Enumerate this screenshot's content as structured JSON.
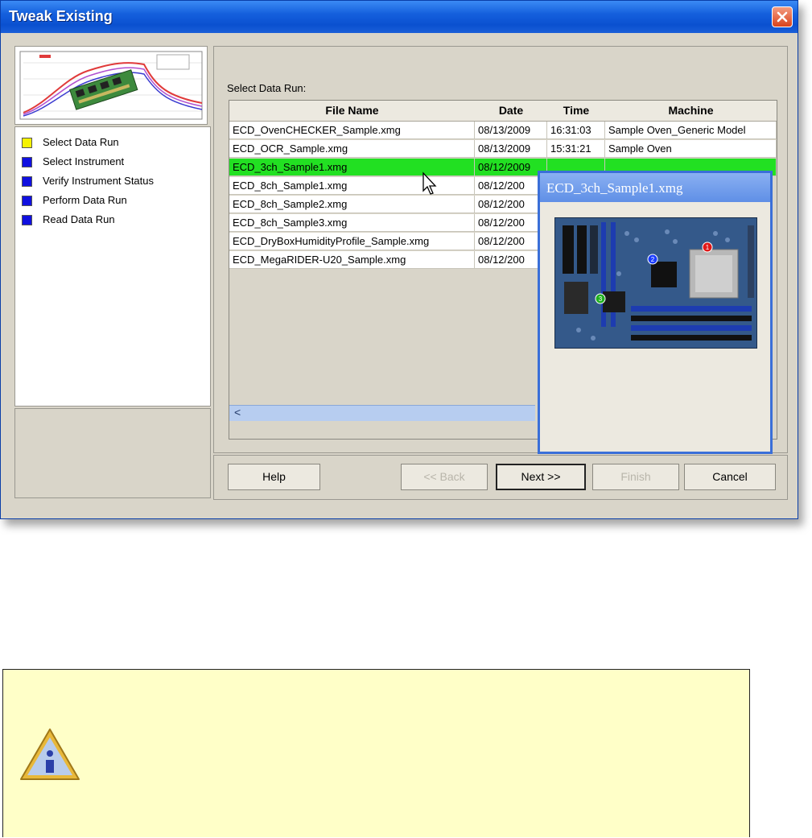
{
  "window": {
    "title": "Tweak Existing",
    "close_glyph": "✕"
  },
  "steps": [
    {
      "label": "Select Data Run",
      "color": "#f5f200"
    },
    {
      "label": "Select Instrument",
      "color": "#1010e0"
    },
    {
      "label": "Verify Instrument Status",
      "color": "#1010e0"
    },
    {
      "label": "Perform Data Run",
      "color": "#1010e0"
    },
    {
      "label": "Read Data Run",
      "color": "#1010e0"
    }
  ],
  "main": {
    "select_label": "Select Data Run:",
    "columns": [
      "File Name",
      "Date",
      "Time",
      "Machine"
    ],
    "rows": [
      {
        "file": "ECD_OvenCHECKER_Sample.xmg",
        "date": "08/13/2009",
        "time": "16:31:03",
        "machine": "Sample Oven_Generic Model"
      },
      {
        "file": "ECD_OCR_Sample.xmg",
        "date": "08/13/2009",
        "time": "15:31:21",
        "machine": "Sample Oven"
      },
      {
        "file": "ECD_3ch_Sample1.xmg",
        "date": "08/12/2009",
        "time": "",
        "machine": "",
        "selected": true
      },
      {
        "file": "ECD_8ch_Sample1.xmg",
        "date": "08/12/200",
        "time": "",
        "machine": ""
      },
      {
        "file": "ECD_8ch_Sample2.xmg",
        "date": "08/12/200",
        "time": "",
        "machine": ""
      },
      {
        "file": "ECD_8ch_Sample3.xmg",
        "date": "08/12/200",
        "time": "",
        "machine": ""
      },
      {
        "file": "ECD_DryBoxHumidityProfile_Sample.xmg",
        "date": "08/12/200",
        "time": "",
        "machine": ""
      },
      {
        "file": "ECD_MegaRIDER-U20_Sample.xmg",
        "date": "08/12/200",
        "time": "",
        "machine": ""
      }
    ],
    "scroll_left_glyph": "<"
  },
  "popup": {
    "title": "ECD_3ch_Sample1.xmg",
    "markers": [
      "1",
      "2",
      "3"
    ]
  },
  "buttons": {
    "help": "Help",
    "back": "<< Back",
    "next": "Next >>",
    "finish": "Finish",
    "cancel": "Cancel"
  },
  "colors": {
    "selection": "#22e022",
    "titlebar": "#0a50d0",
    "note_bg": "#ffffc8"
  },
  "note": {
    "icon": "info-warning-icon"
  }
}
